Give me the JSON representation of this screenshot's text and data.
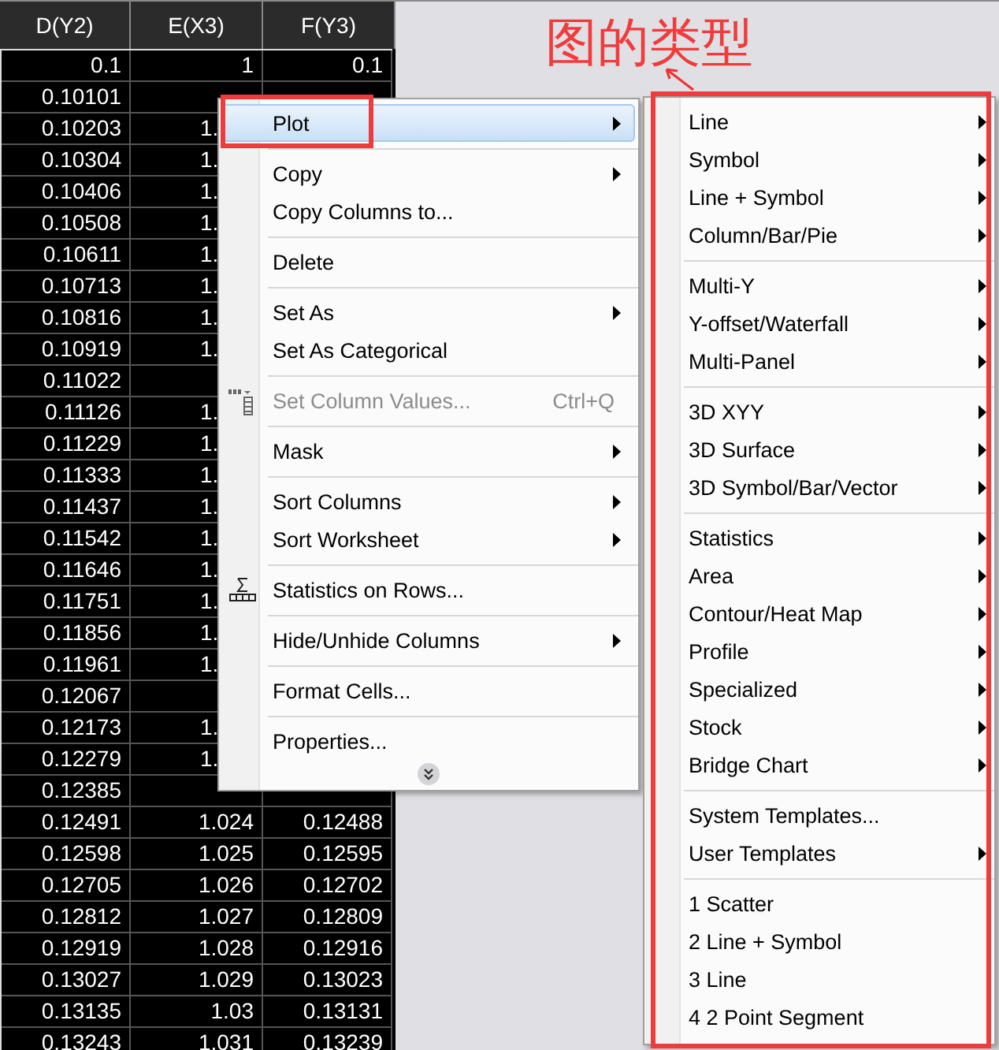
{
  "worksheet": {
    "columns": [
      "D(Y2)",
      "E(X3)",
      "F(Y3)"
    ],
    "rows": [
      {
        "cells": [
          "0.1",
          "1",
          "0.1"
        ]
      },
      {
        "cells": [
          "0.10101"
        ]
      },
      {
        "cells": [
          "0.10203",
          "1."
        ]
      },
      {
        "cells": [
          "0.10304",
          "1."
        ]
      },
      {
        "cells": [
          "0.10406",
          "1."
        ]
      },
      {
        "cells": [
          "0.10508",
          "1."
        ]
      },
      {
        "cells": [
          "0.10611",
          "1."
        ]
      },
      {
        "cells": [
          "0.10713",
          "1."
        ]
      },
      {
        "cells": [
          "0.10816",
          "1."
        ]
      },
      {
        "cells": [
          "0.10919",
          "1."
        ]
      },
      {
        "cells": [
          "0.11022"
        ]
      },
      {
        "cells": [
          "0.11126",
          "1."
        ]
      },
      {
        "cells": [
          "0.11229",
          "1."
        ]
      },
      {
        "cells": [
          "0.11333",
          "1."
        ]
      },
      {
        "cells": [
          "0.11437",
          "1."
        ]
      },
      {
        "cells": [
          "0.11542",
          "1."
        ]
      },
      {
        "cells": [
          "0.11646",
          "1."
        ]
      },
      {
        "cells": [
          "0.11751",
          "1."
        ]
      },
      {
        "cells": [
          "0.11856",
          "1."
        ]
      },
      {
        "cells": [
          "0.11961",
          "1."
        ]
      },
      {
        "cells": [
          "0.12067"
        ]
      },
      {
        "cells": [
          "0.12173",
          "1."
        ]
      },
      {
        "cells": [
          "0.12279",
          "1."
        ]
      },
      {
        "cells": [
          "0.12385"
        ]
      },
      {
        "cells": [
          "0.12491",
          "1.024",
          "0.12488"
        ]
      },
      {
        "cells": [
          "0.12598",
          "1.025",
          "0.12595"
        ]
      },
      {
        "cells": [
          "0.12705",
          "1.026",
          "0.12702"
        ]
      },
      {
        "cells": [
          "0.12812",
          "1.027",
          "0.12809"
        ]
      },
      {
        "cells": [
          "0.12919",
          "1.028",
          "0.12916"
        ]
      },
      {
        "cells": [
          "0.13027",
          "1.029",
          "0.13023"
        ]
      },
      {
        "cells": [
          "0.13135",
          "1.03",
          "0.13131"
        ]
      },
      {
        "cells": [
          "0.13243",
          "1.031",
          "0.13239"
        ]
      }
    ]
  },
  "context_menu": {
    "more": true,
    "groups": [
      [
        {
          "label": "Plot",
          "selected": true,
          "disabled": false,
          "submenu": true
        }
      ],
      [
        {
          "label": "Copy",
          "selected": false,
          "disabled": false,
          "submenu": true
        },
        {
          "label": "Copy Columns to...",
          "selected": false,
          "disabled": false,
          "submenu": false
        }
      ],
      [
        {
          "label": "Delete",
          "selected": false,
          "disabled": false,
          "submenu": false
        }
      ],
      [
        {
          "label": "Set As",
          "selected": false,
          "disabled": false,
          "submenu": true
        },
        {
          "label": "Set As Categorical",
          "selected": false,
          "disabled": false,
          "submenu": false
        }
      ],
      [
        {
          "label": "Set Column Values...",
          "shortcut": "Ctrl+Q",
          "selected": false,
          "disabled": true,
          "submenu": false
        }
      ],
      [
        {
          "label": "Mask",
          "selected": false,
          "disabled": false,
          "submenu": true
        }
      ],
      [
        {
          "label": "Sort Columns",
          "selected": false,
          "disabled": false,
          "submenu": true
        },
        {
          "label": "Sort Worksheet",
          "selected": false,
          "disabled": false,
          "submenu": true
        }
      ],
      [
        {
          "label": "Statistics on Rows...",
          "selected": false,
          "disabled": false,
          "submenu": false
        }
      ],
      [
        {
          "label": "Hide/Unhide Columns",
          "selected": false,
          "disabled": false,
          "submenu": true
        }
      ],
      [
        {
          "label": "Format Cells...",
          "selected": false,
          "disabled": false,
          "submenu": false
        }
      ],
      [
        {
          "label": "Properties...",
          "selected": false,
          "disabled": false,
          "submenu": false
        }
      ]
    ]
  },
  "plot_submenu": {
    "groups": [
      [
        {
          "label": "Line",
          "submenu": true
        },
        {
          "label": "Symbol",
          "submenu": true
        },
        {
          "label": "Line + Symbol",
          "submenu": true
        },
        {
          "label": "Column/Bar/Pie",
          "submenu": true
        }
      ],
      [
        {
          "label": "Multi-Y",
          "submenu": true
        },
        {
          "label": "Y-offset/Waterfall",
          "submenu": true
        },
        {
          "label": "Multi-Panel",
          "submenu": true
        }
      ],
      [
        {
          "label": "3D XYY",
          "submenu": true
        },
        {
          "label": "3D Surface",
          "submenu": true
        },
        {
          "label": "3D Symbol/Bar/Vector",
          "submenu": true
        }
      ],
      [
        {
          "label": "Statistics",
          "submenu": true
        },
        {
          "label": "Area",
          "submenu": true
        },
        {
          "label": "Contour/Heat Map",
          "submenu": true
        },
        {
          "label": "Profile",
          "submenu": true
        },
        {
          "label": "Specialized",
          "submenu": true
        },
        {
          "label": "Stock",
          "submenu": true
        },
        {
          "label": "Bridge Chart",
          "submenu": true
        }
      ],
      [
        {
          "label": "System Templates...",
          "submenu": false
        },
        {
          "label": "User Templates",
          "submenu": true
        }
      ],
      [
        {
          "label": "1 Scatter",
          "submenu": false
        },
        {
          "label": "2 Line + Symbol",
          "submenu": false
        },
        {
          "label": "3 Line",
          "submenu": false
        },
        {
          "label": "4 2 Point Segment",
          "submenu": false
        }
      ]
    ]
  },
  "annotation": {
    "text": "图的类型"
  }
}
